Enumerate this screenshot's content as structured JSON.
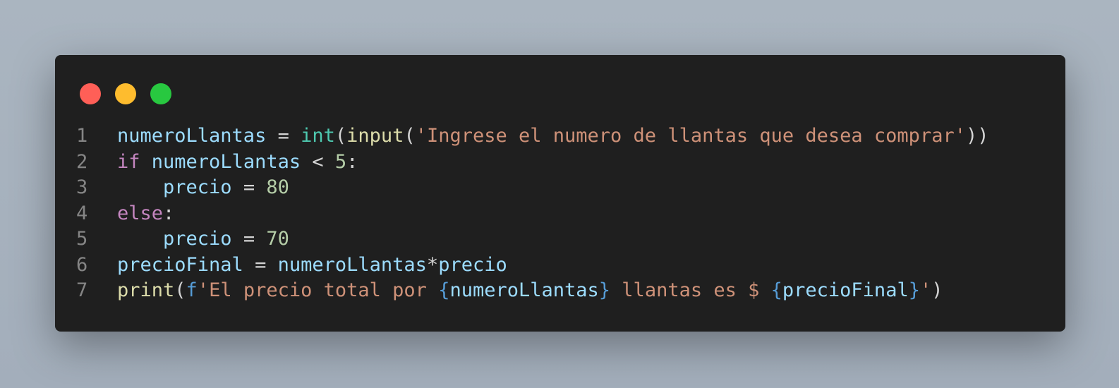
{
  "window": {
    "controls": [
      {
        "name": "close",
        "color": "#ff5f57"
      },
      {
        "name": "minimize",
        "color": "#febc2e"
      },
      {
        "name": "maximize",
        "color": "#28c840"
      }
    ]
  },
  "colors": {
    "background": "#1f1f1f",
    "line_number": "#858585",
    "variable": "#9cdcfe",
    "builtin": "#4ec9b0",
    "function": "#dcdcaa",
    "string": "#ce9178",
    "keyword": "#c586c0",
    "number": "#b5cea8",
    "operator": "#d4d4d4",
    "fprefix": "#569cd6"
  },
  "code": {
    "lines": [
      {
        "number": "1",
        "tokens": [
          {
            "text": "numeroLlantas",
            "type": "variable"
          },
          {
            "text": " = ",
            "type": "operator"
          },
          {
            "text": "int",
            "type": "builtin"
          },
          {
            "text": "(",
            "type": "operator"
          },
          {
            "text": "input",
            "type": "function"
          },
          {
            "text": "(",
            "type": "operator"
          },
          {
            "text": "'Ingrese el numero de llantas que desea comprar'",
            "type": "string"
          },
          {
            "text": "))",
            "type": "operator"
          }
        ]
      },
      {
        "number": "2",
        "tokens": [
          {
            "text": "if",
            "type": "keyword"
          },
          {
            "text": " ",
            "type": "operator"
          },
          {
            "text": "numeroLlantas",
            "type": "variable"
          },
          {
            "text": " < ",
            "type": "operator"
          },
          {
            "text": "5",
            "type": "number"
          },
          {
            "text": ":",
            "type": "operator"
          }
        ]
      },
      {
        "number": "3",
        "tokens": [
          {
            "text": "    ",
            "type": "operator"
          },
          {
            "text": "precio",
            "type": "variable"
          },
          {
            "text": " = ",
            "type": "operator"
          },
          {
            "text": "80",
            "type": "number"
          }
        ]
      },
      {
        "number": "4",
        "tokens": [
          {
            "text": "else",
            "type": "keyword"
          },
          {
            "text": ":",
            "type": "operator"
          }
        ]
      },
      {
        "number": "5",
        "tokens": [
          {
            "text": "    ",
            "type": "operator"
          },
          {
            "text": "precio",
            "type": "variable"
          },
          {
            "text": " = ",
            "type": "operator"
          },
          {
            "text": "70",
            "type": "number"
          }
        ]
      },
      {
        "number": "6",
        "tokens": [
          {
            "text": "precioFinal",
            "type": "variable"
          },
          {
            "text": " = ",
            "type": "operator"
          },
          {
            "text": "numeroLlantas",
            "type": "variable"
          },
          {
            "text": "*",
            "type": "operator"
          },
          {
            "text": "precio",
            "type": "variable"
          }
        ]
      },
      {
        "number": "7",
        "tokens": [
          {
            "text": "print",
            "type": "function"
          },
          {
            "text": "(",
            "type": "operator"
          },
          {
            "text": "f",
            "type": "fprefix"
          },
          {
            "text": "'El precio total por ",
            "type": "string"
          },
          {
            "text": "{",
            "type": "fprefix"
          },
          {
            "text": "numeroLlantas",
            "type": "variable"
          },
          {
            "text": "}",
            "type": "fprefix"
          },
          {
            "text": " llantas es $ ",
            "type": "string"
          },
          {
            "text": "{",
            "type": "fprefix"
          },
          {
            "text": "precioFinal",
            "type": "variable"
          },
          {
            "text": "}",
            "type": "fprefix"
          },
          {
            "text": "'",
            "type": "string"
          },
          {
            "text": ")",
            "type": "operator"
          }
        ]
      }
    ]
  }
}
